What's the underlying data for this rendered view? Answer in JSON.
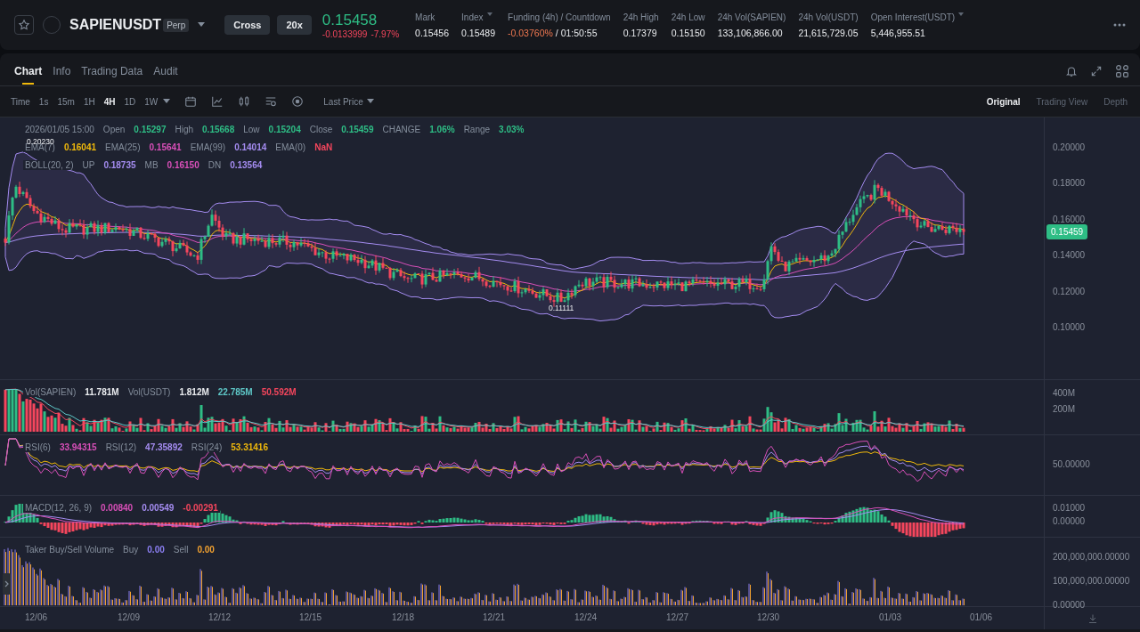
{
  "header": {
    "symbol": "SAPIENUSDT",
    "contract_type": "Perp",
    "margin_mode": "Cross",
    "leverage": "20x",
    "last_price": "0.15458",
    "change": "-0.0133999",
    "change_percent": "-7.97%",
    "stats": [
      {
        "label": "Mark",
        "value": "0.15456"
      },
      {
        "label": "Index",
        "value": "0.15489",
        "info_icon": true
      },
      {
        "label": "Funding (4h) / Countdown",
        "value": "-0.03760%",
        "countdown": "/ 01:50:55"
      },
      {
        "label": "24h High",
        "value": "0.17379"
      },
      {
        "label": "24h Low",
        "value": "0.15150"
      },
      {
        "label": "24h Vol(SAPIEN)",
        "value": "133,106,866.00"
      },
      {
        "label": "24h Vol(USDT)",
        "value": "21,615,729.05"
      },
      {
        "label": "Open Interest(USDT)",
        "value": "5,446,955.51",
        "info_icon": true
      }
    ]
  },
  "tabs": [
    {
      "label": "Chart",
      "selected": true
    },
    {
      "label": "Info",
      "selected": false
    },
    {
      "label": "Trading Data",
      "selected": false
    },
    {
      "label": "Audit",
      "selected": false
    }
  ],
  "intervals": [
    {
      "label": "Time",
      "selected": false
    },
    {
      "label": "1s",
      "selected": false
    },
    {
      "label": "15m",
      "selected": false
    },
    {
      "label": "1H",
      "selected": false
    },
    {
      "label": "4H",
      "selected": true
    },
    {
      "label": "1D",
      "selected": false
    },
    {
      "label": "1W",
      "selected": false
    }
  ],
  "price_type": "Last Price",
  "view_modes": [
    {
      "label": "Original",
      "selected": true
    },
    {
      "label": "Trading View",
      "selected": false
    },
    {
      "label": "Depth",
      "selected": false
    }
  ],
  "price_pane": {
    "legend_lines": [
      [
        {
          "label": "2026/01/05 15:00"
        },
        {
          "label": "Open",
          "value": "0.15297",
          "color": "#2ebd85"
        },
        {
          "label": "High",
          "value": "0.15668",
          "color": "#2ebd85"
        },
        {
          "label": "Low",
          "value": "0.15204",
          "color": "#2ebd85"
        },
        {
          "label": "Close",
          "value": "0.15459",
          "color": "#2ebd85"
        },
        {
          "label": "CHANGE",
          "value": "1.06%",
          "color": "#2ebd85"
        },
        {
          "label": "Range",
          "value": "3.03%",
          "color": "#2ebd85"
        }
      ],
      [
        {
          "label": "EMA(7)",
          "value": "0.16041",
          "color": "#f0b90b"
        },
        {
          "label": "EMA(25)",
          "value": "0.15641",
          "color": "#d84fb8"
        },
        {
          "label": "EMA(99)",
          "value": "0.14014",
          "color": "#a48cf0"
        },
        {
          "label": "EMA(0)",
          "value": "NaN",
          "color": "#f6465d"
        }
      ],
      [
        {
          "label": "BOLL(20, 2)"
        },
        {
          "label": "UP",
          "value": "0.18735",
          "color": "#a48cf0"
        },
        {
          "label": "MB",
          "value": "0.16150",
          "color": "#d84fb8"
        },
        {
          "label": "DN",
          "value": "0.13564",
          "color": "#a48cf0"
        }
      ]
    ],
    "high_marker": "0.20230",
    "low_marker": "0.11111",
    "current_price_tag": "0.15459",
    "ticks": [
      "0.20000",
      "0.18000",
      "0.16000",
      "0.14000",
      "0.12000",
      "0.10000"
    ]
  },
  "volume_pane": {
    "legend": [
      {
        "label": "Vol(SAPIEN)",
        "value": "11.781M",
        "color": "#eaecef"
      },
      {
        "label": "Vol(USDT)",
        "value": "1.812M",
        "color": "#eaecef"
      },
      {
        "value": "22.785M",
        "color": "#5ec8c8"
      },
      {
        "value": "50.592M",
        "color": "#f6465d"
      }
    ],
    "ticks": [
      "400M",
      "200M"
    ]
  },
  "rsi_pane": {
    "legend": [
      {
        "label": "RSI(6)",
        "value": "33.94315",
        "color": "#d84fb8"
      },
      {
        "label": "RSI(12)",
        "value": "47.35892",
        "color": "#a48cf0"
      },
      {
        "label": "RSI(24)",
        "value": "53.31416",
        "color": "#f0b90b"
      }
    ],
    "ticks": [
      "50.00000"
    ]
  },
  "macd_pane": {
    "legend": [
      {
        "label": "MACD(12, 26, 9)",
        "value": "0.00840",
        "color": "#d84fb8"
      },
      {
        "value": "0.00549",
        "color": "#a48cf0"
      },
      {
        "value": "-0.00291",
        "color": "#f6465d"
      }
    ],
    "ticks": [
      "0.01000",
      "0.00000"
    ]
  },
  "taker_pane": {
    "legend": [
      {
        "label": "Taker Buy/Sell Volume"
      },
      {
        "label": "Buy",
        "value": "0.00",
        "color": "#8a7ef0"
      },
      {
        "label": "Sell",
        "value": "0.00",
        "color": "#f0a030"
      }
    ],
    "ticks": [
      "200,000,000.00000",
      "100,000,000.00000",
      "0.00000"
    ]
  },
  "dates": [
    "12/06",
    "12/09",
    "12/12",
    "12/15",
    "12/18",
    "12/21",
    "12/24",
    "12/27",
    "12/30",
    "01/03",
    "01/06"
  ]
}
